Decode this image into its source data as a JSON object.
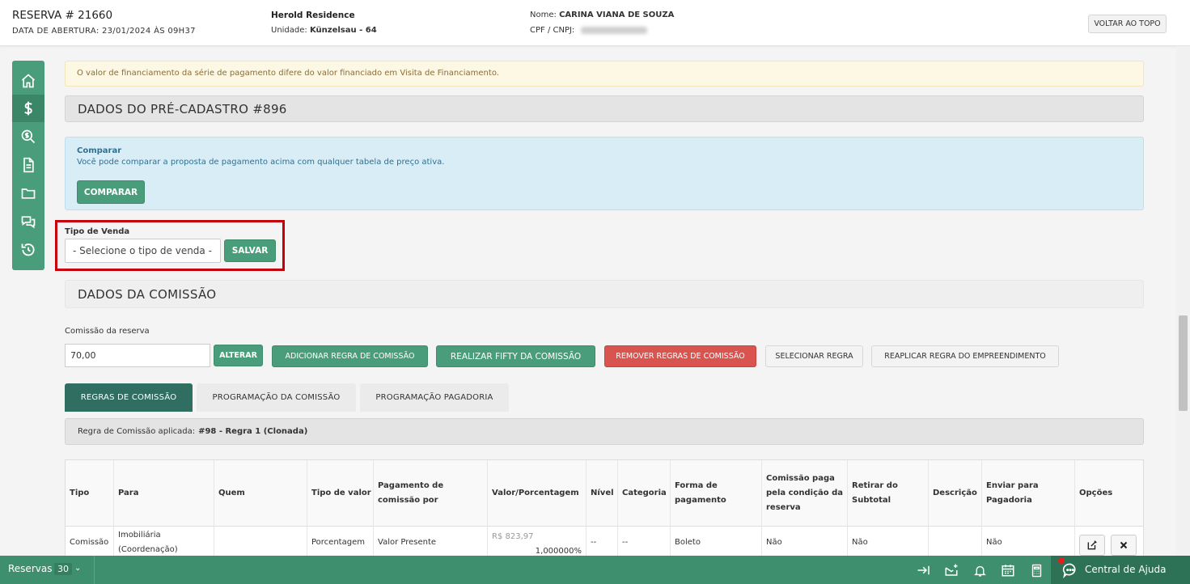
{
  "header": {
    "reservation_title": "RESERVA # 21660",
    "opening_date": "DATA DE ABERTURA: 23/01/2024 ÀS 09H37",
    "development_name": "Herold Residence",
    "unit_label": "Unidade:",
    "unit_value": "Künzelsau - 64",
    "client_label": "Nome:",
    "client_name": "CARINA VIANA DE SOUZA",
    "cpf_label": "CPF / CNPJ:",
    "back_to_top": "VOLTAR AO TOPO"
  },
  "sidebar": {
    "items": [
      {
        "icon": "home-icon"
      },
      {
        "icon": "dollar-icon",
        "active": true
      },
      {
        "icon": "search-dollar-icon"
      },
      {
        "icon": "document-icon"
      },
      {
        "icon": "folder-icon"
      },
      {
        "icon": "chat-icon"
      },
      {
        "icon": "history-icon"
      }
    ]
  },
  "alert": {
    "message": "O valor de financiamento da série de pagamento difere do valor financiado em Visita de Financiamento."
  },
  "pre_registration": {
    "title": "DADOS DO PRÉ-CADASTRO #896"
  },
  "compare": {
    "title": "Comparar",
    "text": "Você pode comparar a proposta de pagamento acima com qualquer tabela de preço ativa.",
    "button": "COMPARAR"
  },
  "sale_type": {
    "label": "Tipo de Venda",
    "select_value": "- Selecione o tipo de venda -",
    "save_button": "SALVAR"
  },
  "commission": {
    "title": "DADOS DA COMISSÃO",
    "reservation_commission_label": "Comissão da reserva",
    "reservation_commission_value": "70,00",
    "buttons": {
      "alter": "ALTERAR",
      "add_rule": "ADICIONAR REGRA DE COMISSÃO",
      "fifty": "REALIZAR FIFTY DA COMISSÃO",
      "remove_rules": "REMOVER REGRAS DE COMISSÃO",
      "select_rule": "SELECIONAR REGRA",
      "reapply_rule": "REAPLICAR REGRA DO EMPREENDIMENTO"
    },
    "tabs": [
      {
        "label": "REGRAS DE COMISSÃO",
        "active": true
      },
      {
        "label": "PROGRAMAÇÃO DA COMISSÃO",
        "active": false
      },
      {
        "label": "PROGRAMAÇÃO PAGADORIA",
        "active": false
      }
    ],
    "applied_rule_label": "Regra de Comissão aplicada:",
    "applied_rule_value": "#98 - Regra 1 (Clonada)",
    "table": {
      "headers": [
        "Tipo",
        "Para",
        "Quem",
        "Tipo de valor",
        "Pagamento de comissão por",
        "Valor/Porcentagem",
        "Nível",
        "Categoria",
        "Forma de pagamento",
        "Comissão paga pela condição da reserva",
        "Retirar do Subtotal",
        "Descrição",
        "Enviar para Pagadoria",
        "Opções"
      ],
      "rows": [
        {
          "tipo": "Comissão",
          "para": "Imobiliária (Coordenação)",
          "quem": "",
          "tipo_valor": "Porcentagem",
          "pagamento_por": "Valor Presente",
          "valor": "R$ 823,97",
          "porcentagem": "1,000000%",
          "nivel": "--",
          "categoria": "--",
          "forma_pagamento": "Boleto",
          "paga_condicao": "Não",
          "retirar_subtotal": "Não",
          "descricao": "",
          "enviar_pagadoria": "Não"
        }
      ]
    }
  },
  "bottom_bar": {
    "reservations_label": "Reservas",
    "reservations_count": "30",
    "help_label": "Central de Ajuda"
  },
  "colors": {
    "primary_green": "#4a9d7a",
    "dark_green": "#2f6e60",
    "danger": "#d9534f",
    "highlight_border": "#c4000b"
  }
}
